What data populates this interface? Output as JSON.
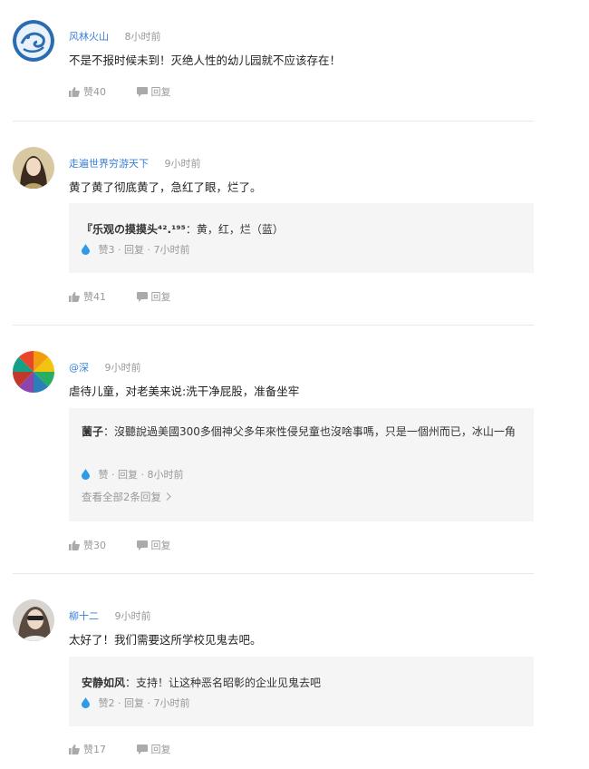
{
  "comments": [
    {
      "username": "风林火山",
      "time": "8小时前",
      "text": "不是不报时候未到！灭绝人性的幼儿园就不应该存在！",
      "like_label": "赞40",
      "reply_label": "回复"
    },
    {
      "username": "走遍世界穷游天下",
      "time": "9小时前",
      "text": "黄了黄了彻底黄了，急红了眼，烂了。",
      "reply": {
        "name": "『乐观の摸摸头⁴².¹⁹⁵",
        "text": "：黄，红，烂（蓝）",
        "meta": "赞3 · 回复 · 7小时前"
      },
      "like_label": "赞41",
      "reply_label": "回复"
    },
    {
      "username": "@深",
      "time": "9小时前",
      "text": "虐待儿童，对老美来说:洗干净屁股，准备坐牢",
      "reply": {
        "name": "薗子",
        "text": "：沒聽說過美國300多個神父多年來性侵兒童也沒啥事嗎，只是一個州而已，冰山一角",
        "meta": "赞 · 回复 · 8小时前",
        "more": "查看全部2条回复"
      },
      "like_label": "赞30",
      "reply_label": "回复"
    },
    {
      "username": "柳十二",
      "time": "9小时前",
      "text": "太好了！我们需要这所学校见鬼去吧。",
      "reply": {
        "name": "安静如风",
        "text": "：支持！让这种恶名昭彰的企业见鬼去吧",
        "meta": "赞2 · 回复 · 7小时前"
      },
      "like_label": "赞17",
      "reply_label": "回复"
    }
  ],
  "colors": {
    "username": "#3a80d9",
    "muted": "#999999",
    "reply_bg": "#f5f5f5",
    "drop": "#2f9be8"
  },
  "icons": {
    "like": "thumbs-up-icon",
    "reply": "speech-bubble-icon",
    "reply_like": "water-drop-icon",
    "more": "chevron-right-icon"
  }
}
